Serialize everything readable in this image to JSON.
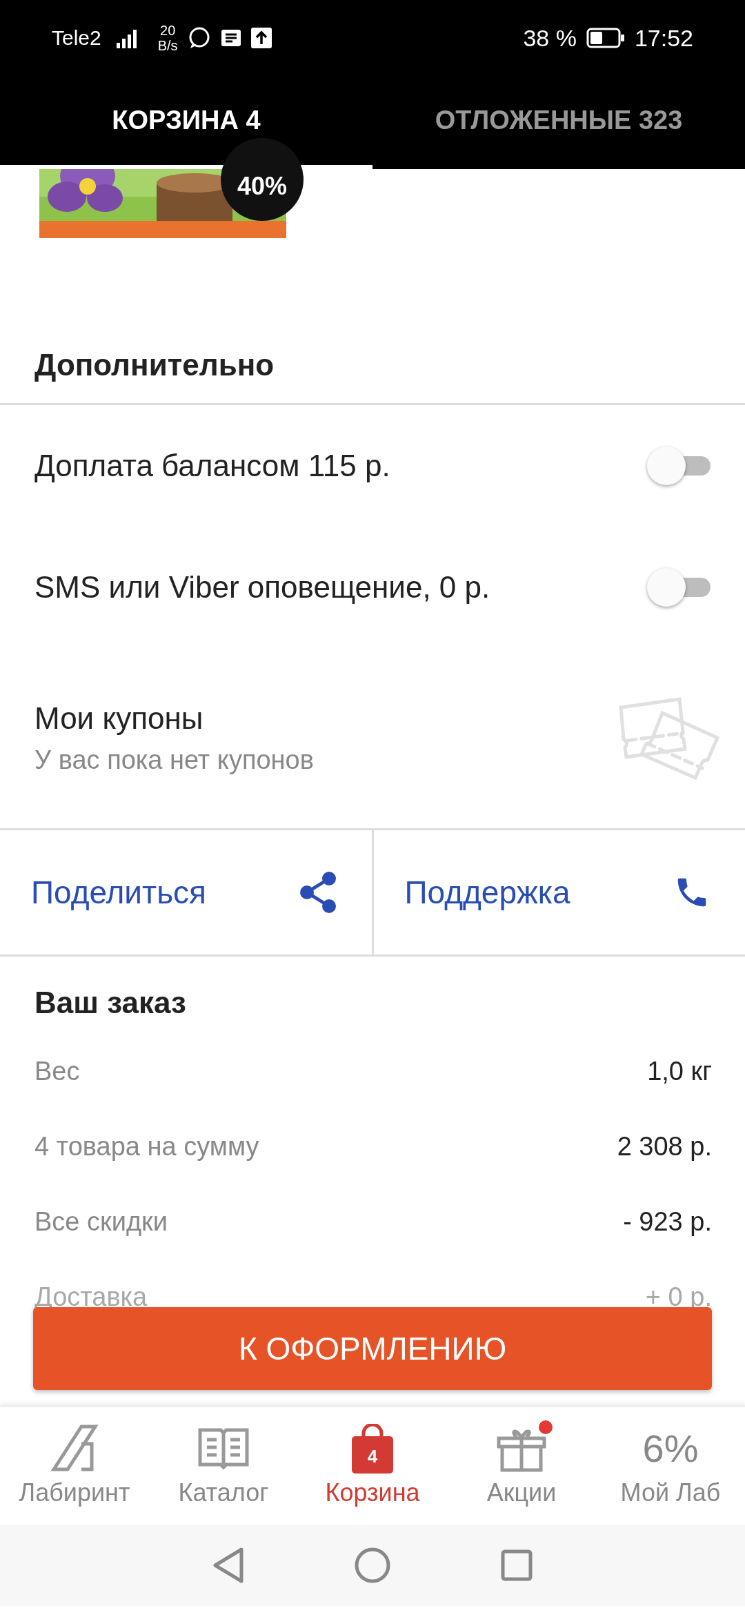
{
  "status_bar": {
    "carrier": "Tele2",
    "net_speed": "20",
    "net_unit": "B/s",
    "battery": "38 %",
    "time": "17:52"
  },
  "tabs": [
    {
      "label": "КОРЗИНА 4",
      "selected": true
    },
    {
      "label": "ОТЛОЖЕННЫЕ 323",
      "selected": false
    }
  ],
  "product": {
    "kind": "picture",
    "discount": "40%"
  },
  "extras": {
    "title": "Дополнительно",
    "toggles": [
      {
        "label": "Доплата балансом 115 р.",
        "on": false
      },
      {
        "label": "SMS или Viber оповещение, 0 р.",
        "on": false
      }
    ],
    "coupons": {
      "title": "Мои купоны",
      "subtitle": "У вас пока нет купонов"
    }
  },
  "actions": [
    {
      "label": "Поделиться",
      "kind": "share"
    },
    {
      "label": "Поддержка",
      "kind": "phone"
    }
  ],
  "order": {
    "title": "Ваш заказ",
    "rows": [
      {
        "label": "Вес",
        "value": "1,0 кг",
        "faded": false
      },
      {
        "label": "4 товара на сумму",
        "value": "2 308 р.",
        "faded": false
      },
      {
        "label": "Все скидки",
        "value": "- 923 р.",
        "faded": false
      },
      {
        "label": "Доставка",
        "value": "+ 0 р.",
        "faded": true
      }
    ]
  },
  "checkout_button": "К ОФОРМЛЕНИЮ",
  "bottom_nav": [
    {
      "label": "Лабиринт",
      "kind": "logo",
      "selected": false
    },
    {
      "label": "Каталог",
      "kind": "book",
      "selected": false
    },
    {
      "label": "Корзина",
      "kind": "bag",
      "badge": "4",
      "selected": true
    },
    {
      "label": "Акции",
      "kind": "gift",
      "dot": true,
      "selected": false
    },
    {
      "label": "Мой Лаб",
      "kind": "text",
      "icon_text": "6%",
      "selected": false
    }
  ]
}
